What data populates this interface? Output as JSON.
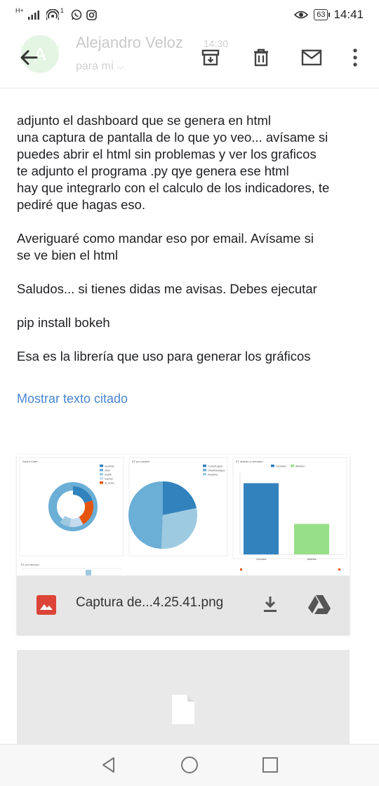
{
  "status_bar": {
    "network": "H+",
    "notif_count": "1",
    "battery": "63",
    "time": "14:41"
  },
  "header": {
    "avatar_letter": "A",
    "sender": "Alejandro Veloz",
    "time": "14:30",
    "recipient": "para mí"
  },
  "icons": {
    "back": "arrow-left-icon",
    "archive": "archive-icon",
    "delete": "trash-icon",
    "mark_unread": "mail-icon",
    "more": "more-vert-icon"
  },
  "body": {
    "lines": [
      "adjunto el dashboard que se genera en html",
      "una captura de pantalla de lo que yo veo... avísame si",
      "puedes abrir el html sin problemas y ver los graficos",
      "te adjunto el programa .py qye genera ese html",
      "hay que integrarlo con el calculo de los indicadores, te",
      "pediré que hagas eso."
    ],
    "para2_l1": "Averiguaré como mandar eso por email. Avísame si",
    "para2_l2": "se ve bien el html",
    "para3": "Saludos... si tienes didas me avisas. Debes ejecutar",
    "para4": "pip install bokeh",
    "para5": "Esa es la librería que uso para generar los gráficos",
    "show_quoted": "Mostrar texto citado"
  },
  "attachment": {
    "filename": "Captura de...4.25.41.png",
    "thumb": {
      "donut_title": "Donut Chart",
      "donut_legend": [
        "vendrías",
        "other",
        "health",
        "teacher",
        "at_home"
      ],
      "pie_title": "ET por ciudad",
      "pie_legend": [
        "Curicó/Lagos",
        "Otra/Rancagua",
        "Pedalina"
      ],
      "bar_title": "ET abierto y cerrados",
      "bar_legend": [
        "Cerrados",
        "Abiertos"
      ],
      "bar_categories": [
        "Cerrados",
        "Abiertos"
      ],
      "bar_values": [
        70,
        30
      ],
      "bottom_title": "ET por técnico"
    }
  },
  "colors": {
    "blue_dark": "#3182bd",
    "blue_mid": "#6baed6",
    "blue_light": "#9ecae1",
    "blue_pale": "#c6dbef",
    "orange": "#e6550d",
    "green": "#98df8a",
    "link": "#4a86d1",
    "drive_grey": "#555555",
    "image_red": "#db4437"
  }
}
